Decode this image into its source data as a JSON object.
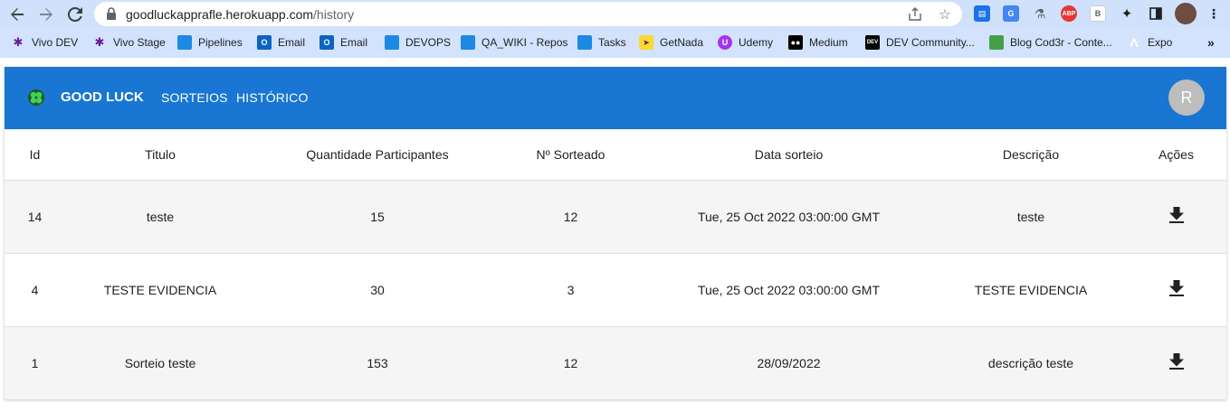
{
  "browser": {
    "url_host": "goodluckapprafle.herokuapp.com",
    "url_path": "/history",
    "bookmarks": [
      {
        "label": "Vivo DEV",
        "icon": "vivo-icon"
      },
      {
        "label": "Vivo Stage",
        "icon": "vivo-icon"
      },
      {
        "label": "Pipelines",
        "icon": "azure-devops-icon"
      },
      {
        "label": "Email",
        "icon": "outlook-icon"
      },
      {
        "label": "Email",
        "icon": "outlook-icon"
      },
      {
        "label": "DEVOPS",
        "icon": "azure-devops-icon"
      },
      {
        "label": "QA_WIKI - Repos",
        "icon": "azure-devops-icon"
      },
      {
        "label": "Tasks",
        "icon": "azure-devops-icon"
      },
      {
        "label": "GetNada",
        "icon": "getnada-icon"
      },
      {
        "label": "Udemy",
        "icon": "udemy-icon"
      },
      {
        "label": "Medium",
        "icon": "medium-icon"
      },
      {
        "label": "DEV Community...",
        "icon": "dev-icon"
      },
      {
        "label": "Blog Cod3r - Conte...",
        "icon": "cod3r-icon"
      },
      {
        "label": "Expo",
        "icon": "expo-icon"
      }
    ],
    "colors": {
      "chrome": "#d3e3fd"
    }
  },
  "app": {
    "brand": "GOOD LUCK",
    "nav": [
      "SORTEIOS",
      "HISTÓRICO"
    ],
    "avatar_letter": "R",
    "accent": "#1976d2"
  },
  "table": {
    "headers": [
      "Id",
      "Titulo",
      "Quantidade Participantes",
      "Nº Sorteado",
      "Data sorteio",
      "Descrição",
      "Ações"
    ],
    "rows": [
      {
        "id": "14",
        "titulo": "teste",
        "participantes": "15",
        "sorteado": "12",
        "data": "Tue, 25 Oct 2022 03:00:00 GMT",
        "descricao": "teste"
      },
      {
        "id": "4",
        "titulo": "TESTE EVIDENCIA",
        "participantes": "30",
        "sorteado": "3",
        "data": "Tue, 25 Oct 2022 03:00:00 GMT",
        "descricao": "TESTE EVIDENCIA"
      },
      {
        "id": "1",
        "titulo": "Sorteio teste",
        "participantes": "153",
        "sorteado": "12",
        "data": "28/09/2022",
        "descricao": "descrição teste"
      }
    ],
    "action_icon": "download-icon"
  }
}
